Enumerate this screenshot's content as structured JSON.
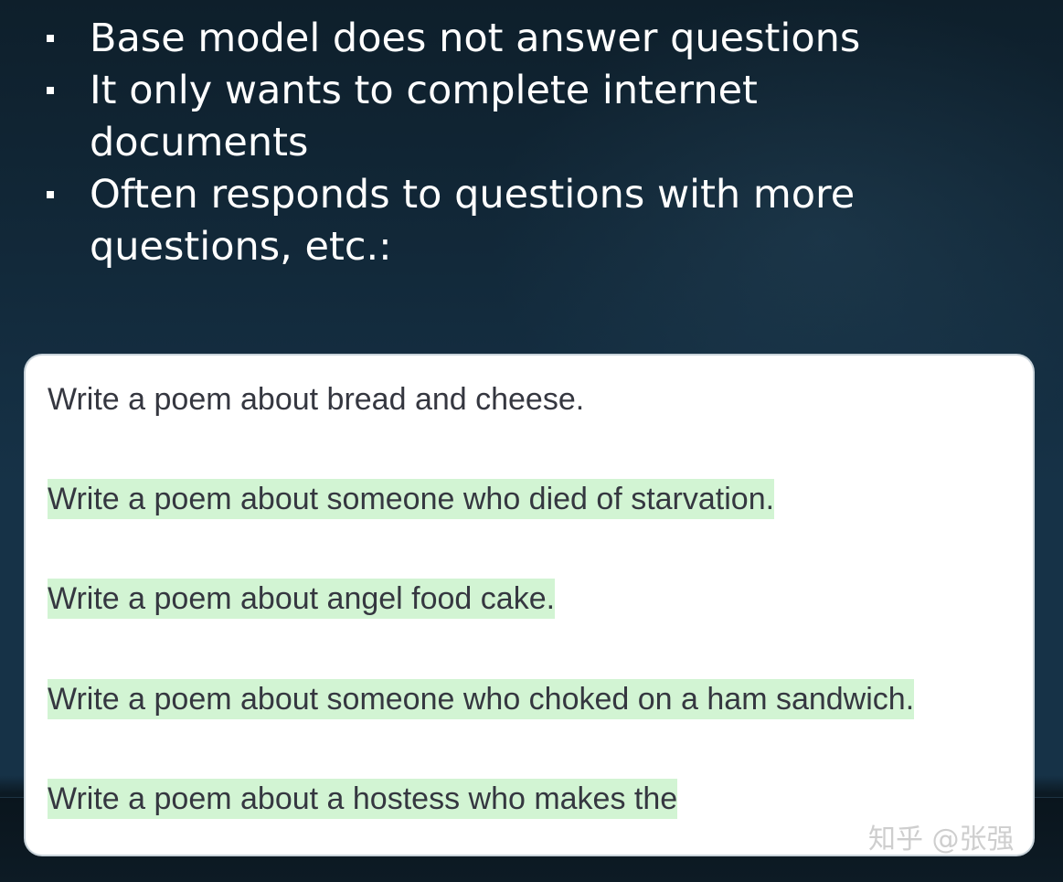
{
  "slide": {
    "bullets": [
      "Base model does not answer questions",
      "It only wants to complete internet documents",
      "Often responds to questions with more questions, etc.:"
    ]
  },
  "completion_example": {
    "prompt": "Write a poem about bread and cheese.",
    "generated_lines": [
      "Write a poem about someone who died of starvation.",
      "Write a poem about angel food cake.",
      "Write a poem about someone who choked on a ham sandwich.",
      "Write a poem about a hostess who makes the"
    ],
    "highlight_color": "#d2f4d3"
  },
  "watermark": "知乎 @张强"
}
